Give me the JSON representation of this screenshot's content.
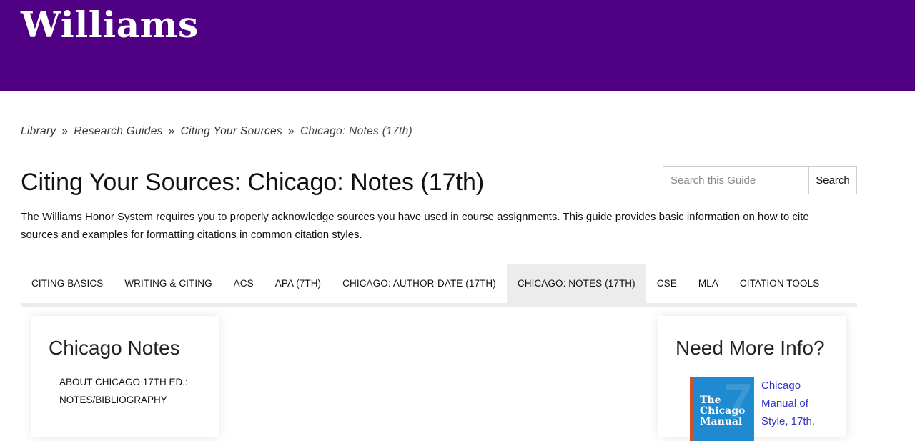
{
  "header": {
    "logo_text": "Williams",
    "color": "#500082"
  },
  "breadcrumb": {
    "items": [
      "Library",
      "Research Guides",
      "Citing Your Sources"
    ],
    "current": "Chicago: Notes (17th)",
    "separator": "»"
  },
  "page": {
    "title": "Citing Your Sources: Chicago: Notes (17th)",
    "description": "The Williams Honor System requires you to properly acknowledge sources you have used in course assignments. This guide provides basic information on how to cite sources and examples for formatting citations in common citation styles."
  },
  "search": {
    "placeholder": "Search this Guide",
    "button_label": "Search"
  },
  "tabs": [
    {
      "label": "CITING BASICS",
      "active": false
    },
    {
      "label": "WRITING & CITING",
      "active": false
    },
    {
      "label": "ACS",
      "active": false
    },
    {
      "label": "APA (7TH)",
      "active": false
    },
    {
      "label": "CHICAGO: AUTHOR-DATE (17TH)",
      "active": false
    },
    {
      "label": "CHICAGO: NOTES (17TH)",
      "active": true
    },
    {
      "label": "CSE",
      "active": false
    },
    {
      "label": "MLA",
      "active": false
    },
    {
      "label": "CITATION TOOLS",
      "active": false
    }
  ],
  "left_box": {
    "title": "Chicago Notes",
    "link": "ABOUT CHICAGO 17TH ED.: NOTES/BIBLIOGRAPHY"
  },
  "right_box": {
    "title": "Need More Info?",
    "book_cover_text": "The Chicago Manual",
    "book_link": "Chicago Manual of Style, 17th."
  }
}
